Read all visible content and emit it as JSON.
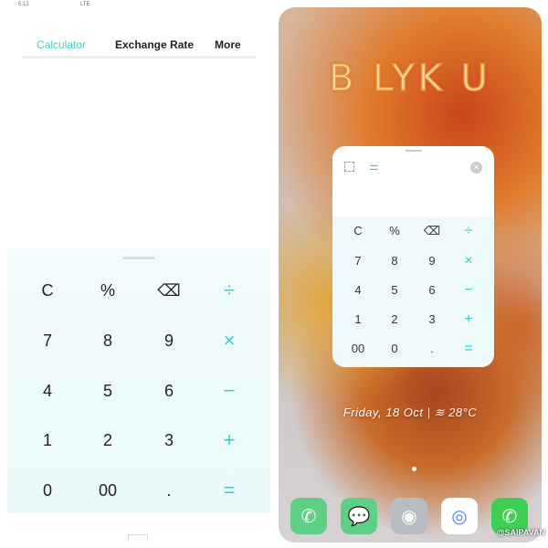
{
  "status_bar": {
    "time": "5:12",
    "network": "LTE"
  },
  "tabs": [
    {
      "label": "Calculator",
      "active": true
    },
    {
      "label": "Exchange Rate"
    },
    {
      "label": "More"
    }
  ],
  "keypad": [
    [
      "C",
      "%",
      "⌫",
      "÷"
    ],
    [
      "7",
      "8",
      "9",
      "×"
    ],
    [
      "4",
      "5",
      "6",
      "−"
    ],
    [
      "1",
      "2",
      "3",
      "+"
    ],
    [
      "0",
      "00",
      ".",
      "="
    ]
  ],
  "floating": {
    "keypad": [
      [
        "C",
        "%",
        "⌫",
        "÷"
      ],
      [
        "7",
        "8",
        "9",
        "×"
      ],
      [
        "4",
        "5",
        "6",
        "−"
      ],
      [
        "1",
        "2",
        "3",
        "+"
      ],
      [
        "00",
        "0",
        ".",
        "="
      ]
    ],
    "icons": [
      "resize-icon",
      "settings-sliders-icon",
      "close-icon"
    ]
  },
  "home": {
    "wallpaper_text": "B LYK U",
    "date": "Friday, 18 Oct",
    "weather_icon": "haze-icon",
    "temperature": "28°C",
    "dock": [
      {
        "app": "Phone",
        "color": "#5fcf85"
      },
      {
        "app": "Messages",
        "color": "#5fcf85"
      },
      {
        "app": "Camera",
        "color": "#b8bcc4"
      },
      {
        "app": "Chrome",
        "color": "#ffffff"
      },
      {
        "app": "WhatsApp",
        "color": "#3fcf55"
      }
    ]
  },
  "watermark": "@SAIPAVAN",
  "colors": {
    "accent": "#34cfcc"
  }
}
